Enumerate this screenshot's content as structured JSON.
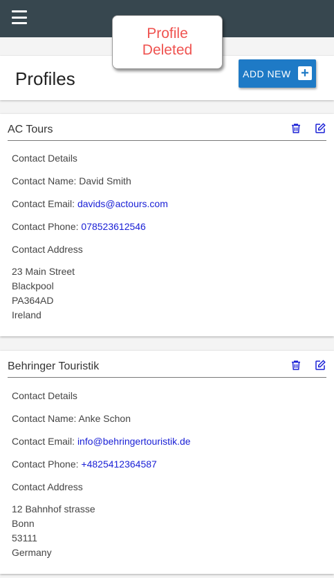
{
  "toast": {
    "message": "Profile Deleted"
  },
  "header": {
    "title": "Profiles",
    "add_button_label": "ADD NEW"
  },
  "profiles": [
    {
      "name": "AC Tours",
      "section_details": "Contact Details",
      "contact_name_label": "Contact Name: ",
      "contact_name": "David Smith",
      "contact_email_label": "Contact Email: ",
      "contact_email": "davids@actours.com",
      "contact_phone_label": "Contact Phone: ",
      "contact_phone": "078523612546",
      "section_address": "Contact Address",
      "address": [
        "23 Main Street",
        "Blackpool",
        "PA364AD",
        "Ireland"
      ]
    },
    {
      "name": "Behringer Touristik",
      "section_details": "Contact Details",
      "contact_name_label": "Contact Name: ",
      "contact_name": "Anke Schon",
      "contact_email_label": "Contact Email: ",
      "contact_email": "info@behringertouristik.de",
      "contact_phone_label": "Contact Phone: ",
      "contact_phone": "+4825412364587",
      "section_address": "Contact Address",
      "address": [
        "12 Bahnhof strasse",
        "Bonn",
        "53111",
        "Germany"
      ]
    }
  ],
  "colors": {
    "topbar": "#37474f",
    "accent": "#1e7ac6",
    "toast_text": "#ef5350",
    "link": "#1a20d6"
  }
}
